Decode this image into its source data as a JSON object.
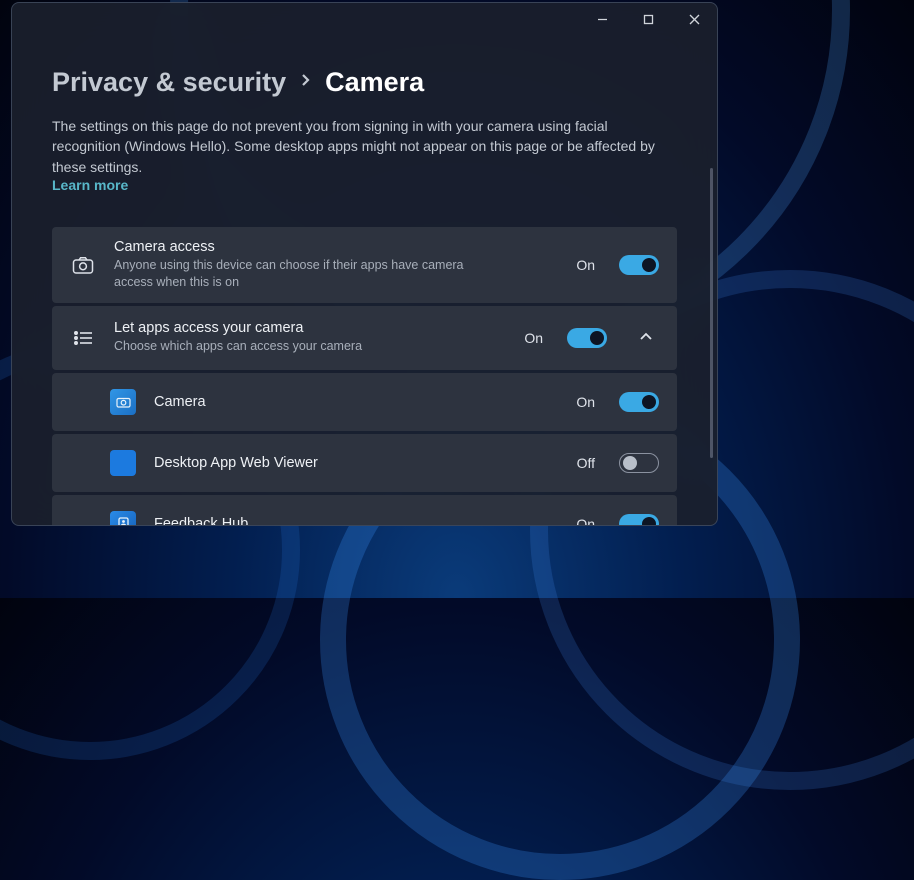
{
  "breadcrumb": {
    "parent": "Privacy & security",
    "current": "Camera"
  },
  "description": "The settings on this page do not prevent you from signing in with your camera using facial recognition (Windows Hello). Some desktop apps might not appear on this page or be affected by these settings.",
  "learn_more": "Learn more",
  "settings": {
    "camera_access": {
      "title": "Camera access",
      "subtitle": "Anyone using this device can choose if their apps have camera access when this is on",
      "state": "On",
      "on": true
    },
    "let_apps": {
      "title": "Let apps access your camera",
      "subtitle": "Choose which apps can access your camera",
      "state": "On",
      "on": true,
      "expanded": true
    }
  },
  "apps": [
    {
      "name": "Camera",
      "state": "On",
      "on": true,
      "icon": "camera"
    },
    {
      "name": "Desktop App Web Viewer",
      "state": "Off",
      "on": false,
      "icon": "generic"
    },
    {
      "name": "Feedback Hub",
      "state": "On",
      "on": true,
      "icon": "feedback"
    }
  ],
  "labels": {
    "on": "On",
    "off": "Off"
  }
}
